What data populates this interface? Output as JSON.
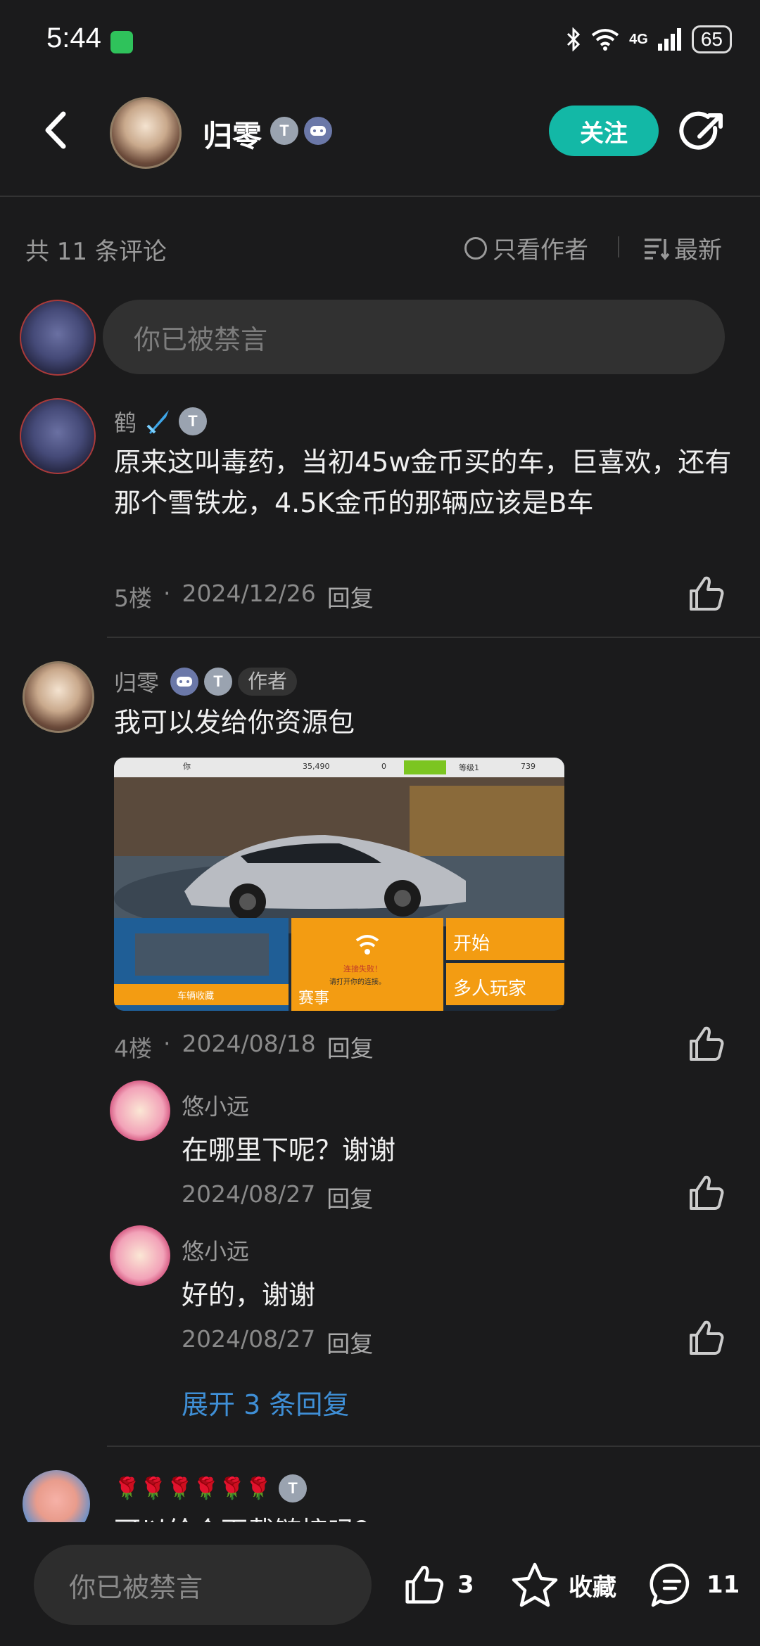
{
  "status_bar": {
    "time": "5:44",
    "network": "4G",
    "battery": "65"
  },
  "header": {
    "name": "归零",
    "follow_label": "关注",
    "badge_t": "T"
  },
  "comments_header": {
    "count_label": "共 11 条评论",
    "author_only_label": "只看作者",
    "sort_label": "最新"
  },
  "input": {
    "placeholder": "你已被禁言"
  },
  "comments": [
    {
      "name": "鹤",
      "text": "原来这叫毒药，当初45w金币买的车，巨喜欢，还有那个雪铁龙，4.5K金币的那辆应该是B车",
      "floor": "5楼",
      "date": "2024/12/26",
      "reply": "回复"
    },
    {
      "name": "归零",
      "author_tag": "作者",
      "text": "我可以发给你资源包",
      "floor": "4楼",
      "date": "2024/08/18",
      "reply": "回复",
      "image": {
        "top_bar": [
          "你",
          "35,490",
          "0",
          "等级1",
          "739"
        ],
        "tiles": [
          "车辆收藏",
          "赛事",
          "开始",
          "多人玩家"
        ],
        "wifi_text": "连接失败！",
        "wifi_sub": "请打开你的连接。"
      },
      "replies": [
        {
          "name": "悠小远",
          "text": "在哪里下呢？谢谢",
          "date": "2024/08/27",
          "reply": "回复"
        },
        {
          "name": "悠小远",
          "text": "好的，谢谢",
          "date": "2024/08/27",
          "reply": "回复"
        }
      ],
      "expand_label": "展开 3 条回复"
    },
    {
      "name": "🌹🌹🌹🌹🌹🌹",
      "text": "可以给个下载链接吗？"
    }
  ],
  "bottom_bar": {
    "placeholder": "你已被禁言",
    "like_count": "3",
    "collect_label": "收藏",
    "comment_count": "11"
  },
  "colors": {
    "accent": "#13b8a6",
    "link": "#3f8fd6",
    "background": "#1b1b1c"
  }
}
